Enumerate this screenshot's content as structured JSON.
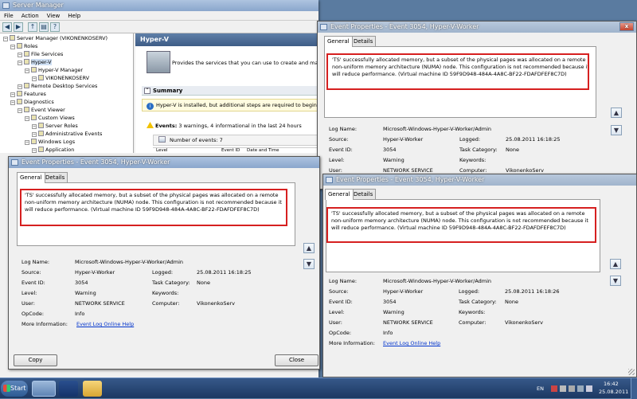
{
  "server_manager": {
    "title": "Server Manager",
    "menu": [
      "File",
      "Action",
      "View",
      "Help"
    ],
    "tree": [
      {
        "label": "Server Manager (VIKONENKOSERV)",
        "depth": 0
      },
      {
        "label": "Roles",
        "depth": 1
      },
      {
        "label": "File Services",
        "depth": 2
      },
      {
        "label": "Hyper-V",
        "depth": 2
      },
      {
        "label": "Hyper-V Manager",
        "depth": 3
      },
      {
        "label": "VIKONENKOSERV",
        "depth": 4
      },
      {
        "label": "Remote Desktop Services",
        "depth": 2
      },
      {
        "label": "Features",
        "depth": 1
      },
      {
        "label": "Diagnostics",
        "depth": 1
      },
      {
        "label": "Event Viewer",
        "depth": 2
      },
      {
        "label": "Custom Views",
        "depth": 3
      },
      {
        "label": "Server Roles",
        "depth": 4
      },
      {
        "label": "Administrative Events",
        "depth": 4
      },
      {
        "label": "Windows Logs",
        "depth": 3
      },
      {
        "label": "Application",
        "depth": 4
      }
    ],
    "main_header": "Hyper-V",
    "role_description": "Provides the services that you can use to create and manag",
    "summary_label": "Summary",
    "summary_text": "Hyper-V is installed, but additional steps are required to begin ru",
    "events_label": "Events:",
    "events_text": "3 warnings, 4 informational in the last 24 hours",
    "number_of_events": "Number of events: 7",
    "col_level": "Level",
    "col_event_id": "Event ID",
    "col_date_time": "Date and Time"
  },
  "dialogs": [
    {
      "title": "Event Properties - Event 3054, Hyper-V-Worker",
      "tab_general": "General",
      "tab_details": "Details",
      "message": "'TS' successfully allocated memory, but a subset of the physical pages was allocated on a remote non-uniform memory architecture (NUMA) node. This configuration is not recommended because it will reduce performance. (Virtual machine ID 59F9D948-484A-4A8C-BF22-FDAFDFEF8C7D)",
      "log_name_label": "Log Name:",
      "log_name": "Microsoft-Windows-Hyper-V-Worker/Admin",
      "source_label": "Source:",
      "source": "Hyper-V-Worker",
      "logged_label": "Logged:",
      "logged": "25.08.2011 16:18:25",
      "event_id_label": "Event ID:",
      "event_id": "3054",
      "task_category_label": "Task Category:",
      "task_category": "None",
      "level_label": "Level:",
      "level": "Warning",
      "keywords_label": "Keywords:",
      "keywords": "",
      "user_label": "User:",
      "user": "NETWORK SERVICE",
      "computer_label": "Computer:",
      "computer": "VikonenkoServ",
      "opcode_label": "OpCode:",
      "opcode": "Info",
      "more_info_label": "More Information:",
      "more_info_link": "Event Log Online Help",
      "copy_button": "Copy",
      "close_button": "Close"
    },
    {
      "title": "Event Properties - Event 3054, Hyper-V-Worker",
      "tab_general": "General",
      "tab_details": "Details",
      "message": "'TS' successfully allocated memory, but a subset of the physical pages was allocated on a remote non-uniform memory architecture (NUMA) node. This configuration is not recommended because it will reduce performance. (Virtual machine ID 59F9D948-484A-4A8C-BF22-FDAFDFEF8C7D)",
      "log_name_label": "Log Name:",
      "log_name": "Microsoft-Windows-Hyper-V-Worker/Admin",
      "source_label": "Source:",
      "source": "Hyper-V-Worker",
      "logged_label": "Logged:",
      "logged": "25.08.2011 16:18:26",
      "event_id_label": "Event ID:",
      "event_id": "3054",
      "task_category_label": "Task Category:",
      "task_category": "None",
      "level_label": "Level:",
      "level": "Warning",
      "keywords_label": "Keywords:",
      "keywords": "",
      "user_label": "User:",
      "user": "NETWORK SERVICE",
      "computer_label": "Computer:",
      "computer": "VikonenkoServ"
    },
    {
      "title": "Event Properties - Event 3054, Hyper-V-Worker",
      "tab_general": "General",
      "tab_details": "Details",
      "message": "'TS' successfully allocated memory, but a subset of the physical pages was allocated on a remote non-uniform memory architecture (NUMA) node. This configuration is not recommended because it will reduce performance. (Virtual machine ID 59F9D948-484A-4A8C-BF22-FDAFDFEF8C7D)",
      "log_name_label": "Log Name:",
      "log_name": "Microsoft-Windows-Hyper-V-Worker/Admin",
      "source_label": "Source:",
      "source": "Hyper-V-Worker",
      "logged_label": "Logged:",
      "logged": "25.08.2011 16:18:26",
      "event_id_label": "Event ID:",
      "event_id": "3054",
      "task_category_label": "Task Category:",
      "task_category": "None",
      "level_label": "Level:",
      "level": "Warning",
      "keywords_label": "Keywords:",
      "keywords": "",
      "user_label": "User:",
      "user": "NETWORK SERVICE",
      "computer_label": "Computer:",
      "computer": "VikonenkoServ",
      "opcode_label": "OpCode:",
      "opcode": "Info",
      "more_info_label": "More Information:",
      "more_info_link": "Event Log Online Help"
    }
  ],
  "taskbar": {
    "start_label": "Start",
    "language": "EN",
    "time": "16:42",
    "date": "25.08.2011"
  },
  "colors": {
    "highlight_box": "#d62020",
    "link": "#0033cc",
    "titlebar": "#8aa6cc"
  }
}
